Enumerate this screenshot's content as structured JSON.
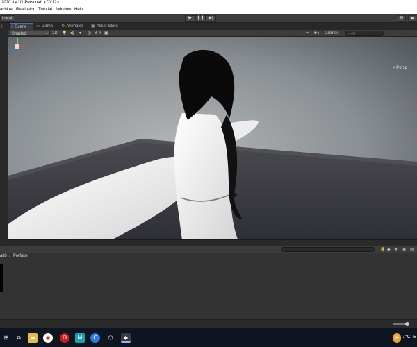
{
  "window": {
    "title": "2020.3.41f1 Personal* <DX12>"
  },
  "menu": [
    "achine",
    "Reallusion",
    "Tutorial",
    "Window",
    "Help"
  ],
  "toolbar": {
    "local_label": "Local",
    "play_icon": "▶",
    "pause_icon": "❚❚",
    "step_icon": "▶|",
    "settings_icon": "⚙",
    "account_icon": "☁"
  },
  "left_strip": {
    "label": "I"
  },
  "tabs": [
    {
      "label": "Scene",
      "icon": "#"
    },
    {
      "label": "Game",
      "icon": "▭"
    },
    {
      "label": "Animator",
      "icon": "⚙"
    },
    {
      "label": "Asset Store",
      "icon": "▣"
    }
  ],
  "scene_options": {
    "shading": "Shaded",
    "mode_2d": "2D",
    "gizmos_label": "Gizmos",
    "search_placeholder": "All"
  },
  "viewport": {
    "persp_label": "< Persp"
  },
  "project": {
    "breadcrumb_parent": "ait8",
    "breadcrumb_sep": "›",
    "breadcrumb_current": "Prefabs",
    "hidden_count": "8"
  },
  "taskbar": {
    "weather": "7°C",
    "tray_letter": "E"
  },
  "colors": {
    "accent": "#3a79bb",
    "editor_dark": "#282828",
    "toolbar": "#3c3c3c",
    "taskbar": "#0f1520"
  }
}
